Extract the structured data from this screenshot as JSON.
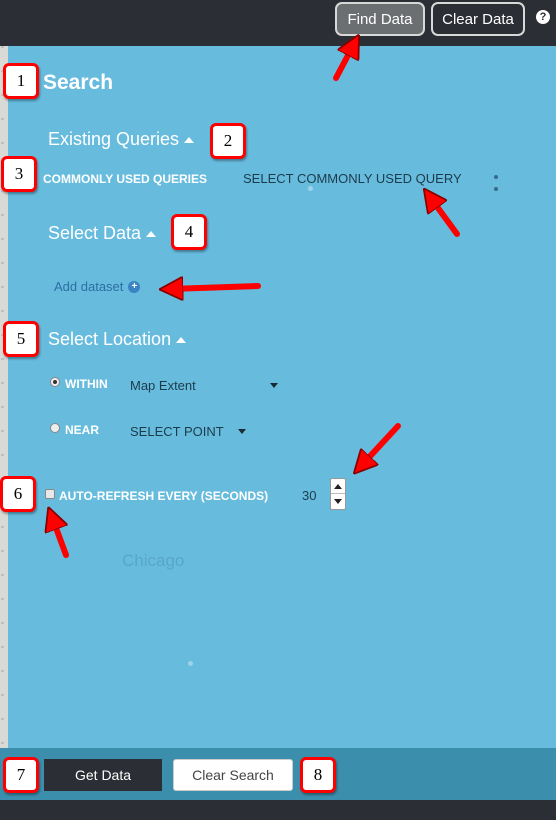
{
  "header": {
    "find_data_label": "Find Data",
    "clear_data_label": "Clear Data",
    "help_icon": "question-mark-icon",
    "help_glyph": "?"
  },
  "map": {
    "city_label": "Chicago"
  },
  "search": {
    "title": "Search",
    "existing_queries": {
      "heading": "Existing Queries",
      "commonly_used_label": "COMMONLY USED QUERIES",
      "commonly_used_placeholder": "SELECT COMMONLY USED QUERY"
    },
    "select_data": {
      "heading": "Select Data",
      "add_dataset_label": "Add dataset"
    },
    "select_location": {
      "heading": "Select Location",
      "within": {
        "label": "WITHIN",
        "value": "Map Extent",
        "selected": true
      },
      "near": {
        "label": "NEAR",
        "value": "SELECT POINT",
        "selected": false
      }
    },
    "auto_refresh": {
      "label": "AUTO-REFRESH EVERY (SECONDS)",
      "value": "30",
      "checked": false
    }
  },
  "footer": {
    "get_data_label": "Get Data",
    "clear_search_label": "Clear Search"
  },
  "annotations": [
    "1",
    "2",
    "3",
    "4",
    "5",
    "6",
    "7",
    "8"
  ],
  "colors": {
    "panel": "#67bcde",
    "footer": "#3c8ead",
    "dark": "#2b2e34",
    "annotation_red": "#ff0000"
  }
}
